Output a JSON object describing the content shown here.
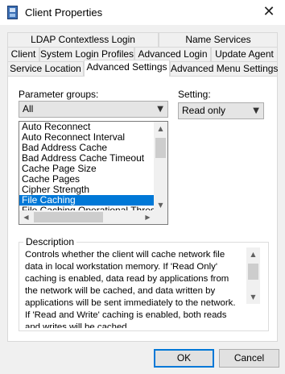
{
  "window": {
    "title": "Client Properties",
    "close_symbol": "✕"
  },
  "tabs": {
    "row1": [
      "LDAP Contextless Login",
      "Name Services"
    ],
    "row2": [
      "Client",
      "System Login Profiles",
      "Advanced Login",
      "Update Agent"
    ],
    "row3": [
      "Service Location",
      "Advanced Settings",
      "Advanced Menu Settings"
    ],
    "active": "Advanced Settings"
  },
  "parameter_groups": {
    "label": "Parameter groups:",
    "selected": "All"
  },
  "setting": {
    "label": "Setting:",
    "selected": "Read only"
  },
  "parameters": {
    "items": [
      "Auto Reconnect",
      "Auto Reconnect Interval",
      "Bad Address Cache",
      "Bad Address Cache Timeout",
      "Cache Page Size",
      "Cache Pages",
      "Cipher Strength",
      "File Caching",
      "File Caching Operational Threshold"
    ],
    "selected_index": 7
  },
  "description": {
    "label": "Description",
    "text": "Controls whether the client will cache network file data in local workstation memory.  If 'Read Only' caching is enabled, data read by applications from the network will be cached, and data written by applications will be sent immediately to the network.  If 'Read and Write' caching is enabled, both reads and writes will be cached."
  },
  "buttons": {
    "ok": "OK",
    "cancel": "Cancel"
  },
  "colors": {
    "selection": "#0078d7",
    "background": "#f0f0f0"
  }
}
